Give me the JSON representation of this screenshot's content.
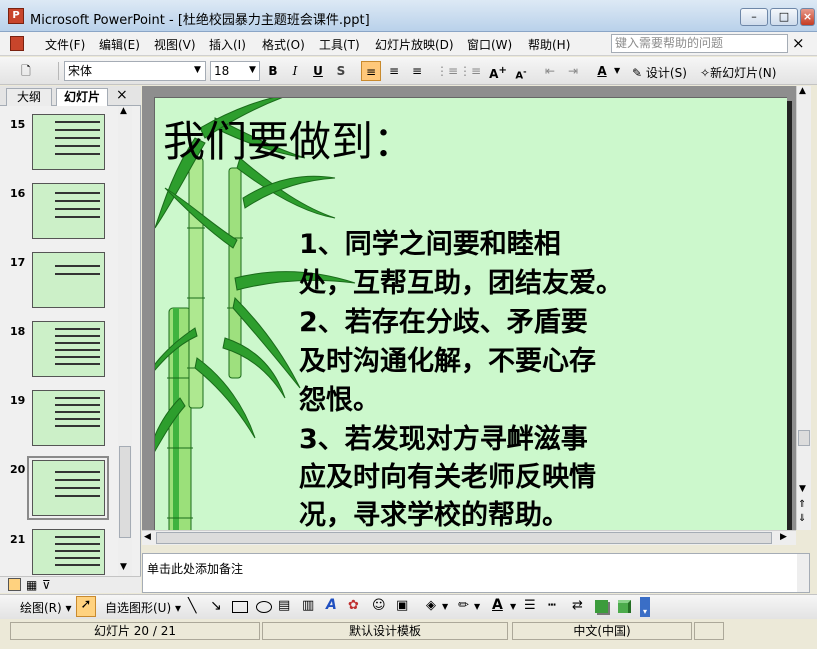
{
  "window": {
    "app_icon": "P",
    "title": "Microsoft PowerPoint - [杜绝校园暴力主题班会课件.ppt]",
    "minimize": "–",
    "maximize": "□",
    "close": "×"
  },
  "menu": {
    "items": [
      "文件(F)",
      "编辑(E)",
      "视图(V)",
      "插入(I)",
      "格式(O)",
      "工具(T)",
      "幻灯片放映(D)",
      "窗口(W)",
      "帮助(H)"
    ],
    "search_placeholder": "键入需要帮助的问题",
    "close_doc": "×"
  },
  "toolbar": {
    "font_name": "宋体",
    "font_size": "18",
    "bold": "B",
    "italic": "I",
    "underline": "U",
    "shadow": "S",
    "design_label": "设计(S)",
    "new_slide_label": "新幻灯片(N)"
  },
  "panel": {
    "tab_outline": "大纲",
    "tab_slides": "幻灯片",
    "close": "×",
    "thumb_numbers": [
      "15",
      "16",
      "17",
      "18",
      "19",
      "20",
      "21"
    ]
  },
  "slide": {
    "title": "我们要做到：",
    "body_lines": [
      "1、同学之间要和睦相",
      "处，互帮互助，团结友爱。",
      "2、若存在分歧、矛盾要",
      "及时沟通化解，不要心存",
      "怨恨。",
      "3、若发现对方寻衅滋事",
      "应及时向有关老师反映情",
      "况，寻求学校的帮助。"
    ]
  },
  "notes": {
    "placeholder": "单击此处添加备注"
  },
  "draw": {
    "draw_label": "绘图(R)",
    "autoshapes_label": "自选图形(U)"
  },
  "status": {
    "slide_counter": "幻灯片 20 / 21",
    "template": "默认设计模板",
    "language": "中文(中国)"
  },
  "colors": {
    "slide_bg": "#ccf8cc",
    "bamboo": "#2d9e2d",
    "title_bar": "#b9d1ea"
  }
}
